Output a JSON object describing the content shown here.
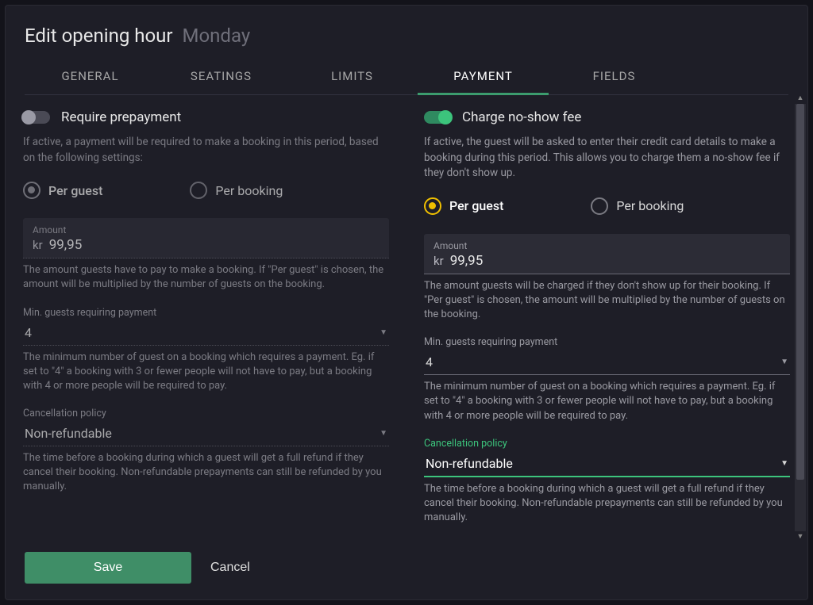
{
  "header": {
    "title": "Edit opening hour",
    "subtitle": "Monday"
  },
  "tabs": {
    "general": "GENERAL",
    "seatings": "SEATINGS",
    "limits": "LIMITS",
    "payment": "PAYMENT",
    "fields": "FIELDS"
  },
  "left": {
    "toggle_label": "Require prepayment",
    "toggle_desc": "If active, a payment will be required to make a booking in this period, based on the following settings:",
    "radio_per_guest": "Per guest",
    "radio_per_booking": "Per booking",
    "amount_label": "Amount",
    "amount_prefix": "kr",
    "amount_value": "99,95",
    "amount_helper": "The amount guests have to pay to make a booking. If \"Per guest\" is chosen, the amount will be multiplied by the number of guests on the booking.",
    "min_guests_label": "Min. guests requiring payment",
    "min_guests_value": "4",
    "min_guests_helper": "The minimum number of guest on a booking which requires a payment. Eg. if set to \"4\" a booking with 3 or fewer people will not have to pay, but a booking with 4 or more people will be required to pay.",
    "cancel_policy_label": "Cancellation policy",
    "cancel_policy_value": "Non-refundable",
    "cancel_policy_helper": "The time before a booking during which a guest will get a full refund if they cancel their booking. Non-refundable prepayments can still be refunded by you manually."
  },
  "right": {
    "toggle_label": "Charge no-show fee",
    "toggle_desc": "If active, the guest will be asked to enter their credit card details to make a booking during this period. This allows you to charge them a no-show fee if they don't show up.",
    "radio_per_guest": "Per guest",
    "radio_per_booking": "Per booking",
    "amount_label": "Amount",
    "amount_prefix": "kr",
    "amount_value": "99,95",
    "amount_helper": "The amount guests will be charged if they don't show up for their booking. If \"Per guest\" is chosen, the amount will be multiplied by the number of guests on the booking.",
    "min_guests_label": "Min. guests requiring payment",
    "min_guests_value": "4",
    "min_guests_helper": "The minimum number of guest on a booking which requires a payment. Eg. if set to \"4\" a booking with 3 or fewer people will not have to pay, but a booking with 4 or more people will be required to pay.",
    "cancel_policy_label": "Cancellation policy",
    "cancel_policy_value": "Non-refundable",
    "cancel_policy_helper": "The time before a booking during which a guest will get a full refund if they cancel their booking. Non-refundable prepayments can still be refunded by you manually."
  },
  "footer": {
    "save": "Save",
    "cancel": "Cancel"
  }
}
